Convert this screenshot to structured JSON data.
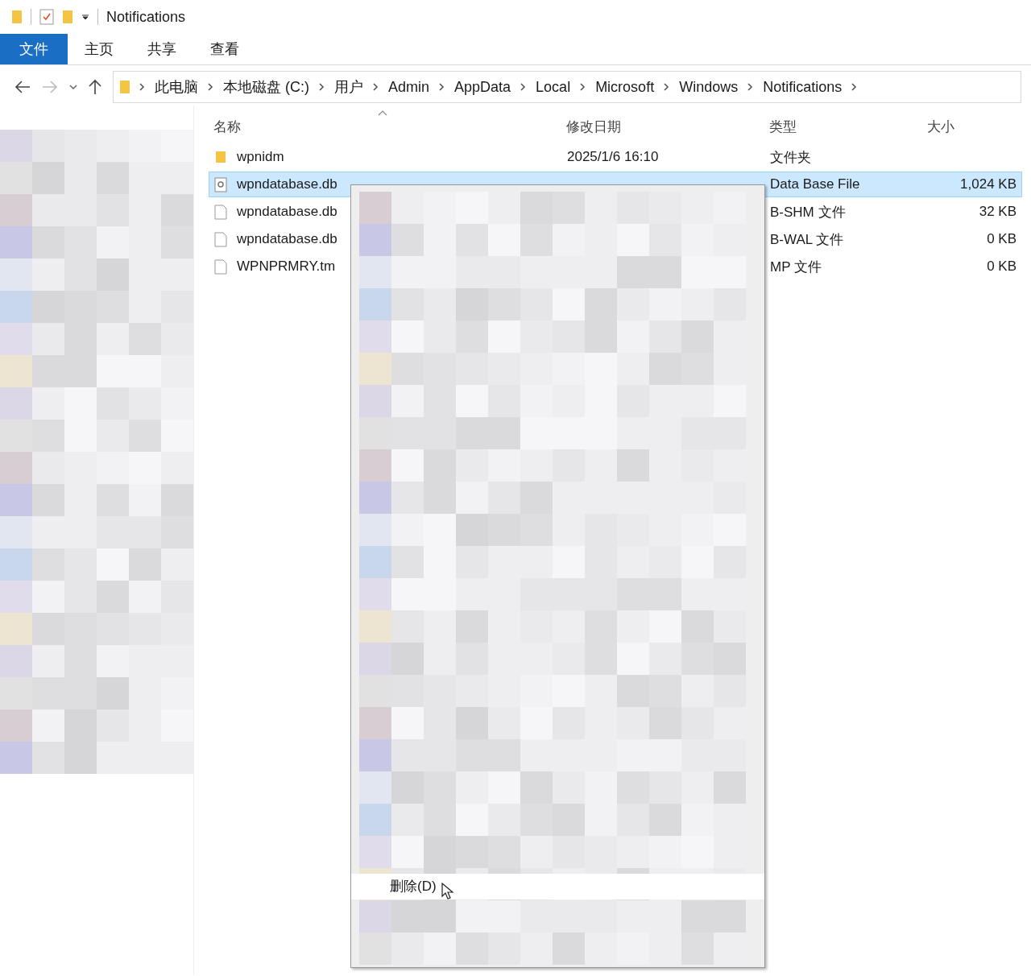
{
  "window": {
    "title": "Notifications"
  },
  "ribbon_tabs": [
    {
      "label": "文件",
      "selected": true
    },
    {
      "label": "主页",
      "selected": false
    },
    {
      "label": "共享",
      "selected": false
    },
    {
      "label": "查看",
      "selected": false
    }
  ],
  "breadcrumb": [
    "此电脑",
    "本地磁盘 (C:)",
    "用户",
    "Admin",
    "AppData",
    "Local",
    "Microsoft",
    "Windows",
    "Notifications"
  ],
  "table": {
    "columns": [
      "名称",
      "修改日期",
      "类型",
      "大小"
    ],
    "rows": [
      {
        "kind": "folder",
        "name": "wpnidm",
        "date": "2025/1/6 16:10",
        "type": "文件夹",
        "selected": false
      },
      {
        "kind": "database",
        "name": "wpndatabase.db",
        "type": "Data Base File",
        "size": "1,024 KB",
        "selected": true
      },
      {
        "kind": "file",
        "name": "wpndatabase.db",
        "type": "B-SHM 文件",
        "size": "32 KB",
        "selected": false
      },
      {
        "kind": "file",
        "name": "wpndatabase.db",
        "type": "B-WAL 文件",
        "size": "0 KB",
        "selected": false
      },
      {
        "kind": "file",
        "name": "WPNPRMRY.tm",
        "type": "MP 文件",
        "size": "0 KB",
        "selected": false
      }
    ]
  },
  "context_menu": {
    "item": "删除(D)"
  }
}
